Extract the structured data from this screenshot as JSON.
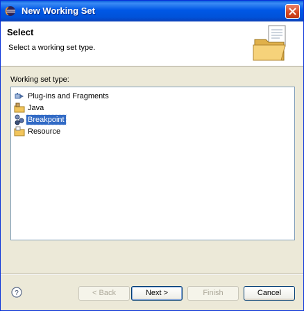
{
  "window": {
    "title": "New Working Set"
  },
  "header": {
    "title": "Select",
    "description": "Select a working set type."
  },
  "list": {
    "label": "Working set type:",
    "items": [
      {
        "label": "Plug-ins and Fragments",
        "icon": "plugin-icon",
        "selected": false
      },
      {
        "label": "Java",
        "icon": "java-package-icon",
        "selected": false
      },
      {
        "label": "Breakpoint",
        "icon": "breakpoint-icon",
        "selected": true
      },
      {
        "label": "Resource",
        "icon": "resource-folder-icon",
        "selected": false
      }
    ]
  },
  "buttons": {
    "back": "< Back",
    "next": "Next >",
    "finish": "Finish",
    "cancel": "Cancel"
  },
  "colors": {
    "titlebar": "#0058e6",
    "selection": "#316ac5",
    "dialog_bg": "#ece9d8"
  }
}
